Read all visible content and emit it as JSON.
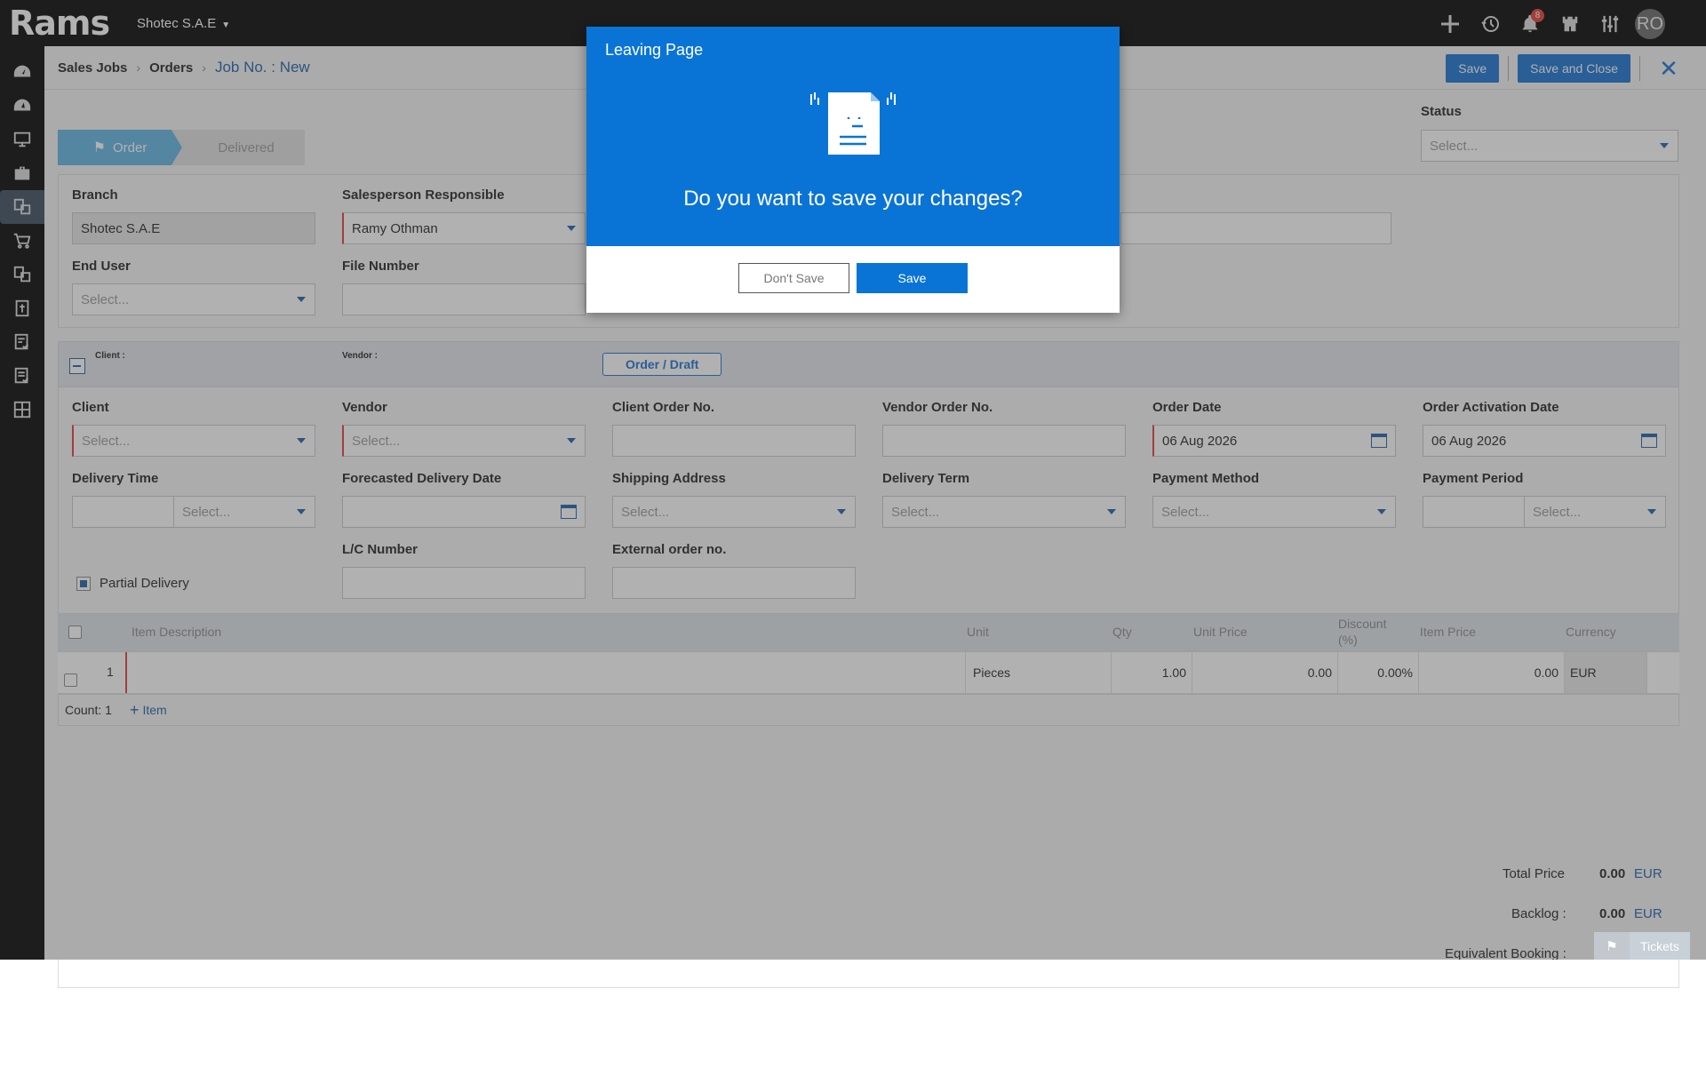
{
  "app": {
    "logo": "Rams",
    "company": "Shotec S.A.E",
    "notification_count": "8",
    "user_initials": "RO"
  },
  "breadcrumb": {
    "sales_jobs": "Sales Jobs",
    "orders": "Orders",
    "current": "Job No. : New"
  },
  "header_actions": {
    "save": "Save",
    "save_close": "Save and Close"
  },
  "stepper": {
    "order": "Order",
    "delivered": "Delivered"
  },
  "status": {
    "label": "Status",
    "placeholder": "Select..."
  },
  "top_form": {
    "branch_label": "Branch",
    "branch_value": "Shotec S.A.E",
    "salesperson_label": "Salesperson Responsible",
    "salesperson_value": "Ramy  Othman",
    "end_user_label": "End User",
    "end_user_value": "Select...",
    "file_number_label": "File Number",
    "file_number_value": ""
  },
  "section_header": {
    "client": "Client :",
    "vendor": "Vendor :",
    "order_draft": "Order / Draft"
  },
  "order_form": {
    "client_label": "Client",
    "client_value": "Select...",
    "vendor_label": "Vendor",
    "vendor_value": "Select...",
    "client_order_label": "Client Order No.",
    "vendor_order_label": "Vendor Order No.",
    "order_date_label": "Order Date",
    "order_date_value": "06 Aug 2026",
    "activation_date_label": "Order Activation Date",
    "activation_date_value": "06 Aug 2026",
    "delivery_time_label": "Delivery Time",
    "delivery_time_unit": "Select...",
    "forecast_label": "Forecasted Delivery Date",
    "shipping_label": "Shipping Address",
    "shipping_value": "Select...",
    "delivery_term_label": "Delivery Term",
    "delivery_term_value": "Select...",
    "payment_method_label": "Payment Method",
    "payment_method_value": "Select...",
    "payment_period_label": "Payment Period",
    "payment_period_unit": "Select...",
    "lc_label": "L/C Number",
    "external_label": "External order no.",
    "partial_delivery": "Partial Delivery"
  },
  "grid": {
    "columns": {
      "description": "Item Description",
      "unit": "Unit",
      "qty": "Qty",
      "unit_price": "Unit Price",
      "discount": "Discount (%)",
      "item_price": "Item Price",
      "currency": "Currency"
    },
    "rows": [
      {
        "no": "1",
        "description": "",
        "unit": "Pieces",
        "qty": "1.00",
        "unit_price": "0.00",
        "discount": "0.00%",
        "item_price": "0.00",
        "currency": "EUR"
      }
    ],
    "count": "Count: 1",
    "add_item": "Item"
  },
  "totals": {
    "total_label": "Total Price",
    "total_value": "0.00",
    "total_currency": "EUR",
    "backlog_label": "Backlog :",
    "backlog_value": "0.00",
    "backlog_currency": "EUR",
    "equivalent_label": "Equivalent Booking :"
  },
  "tickets": "Tickets",
  "modal": {
    "title": "Leaving Page",
    "question": "Do you want to save your changes?",
    "dont_save": "Don't Save",
    "save": "Save"
  },
  "colors": {
    "primary": "#1570d1",
    "modal_blue": "#0a74d6",
    "stepper_active": "#5fb4e3",
    "required": "#e53935"
  }
}
